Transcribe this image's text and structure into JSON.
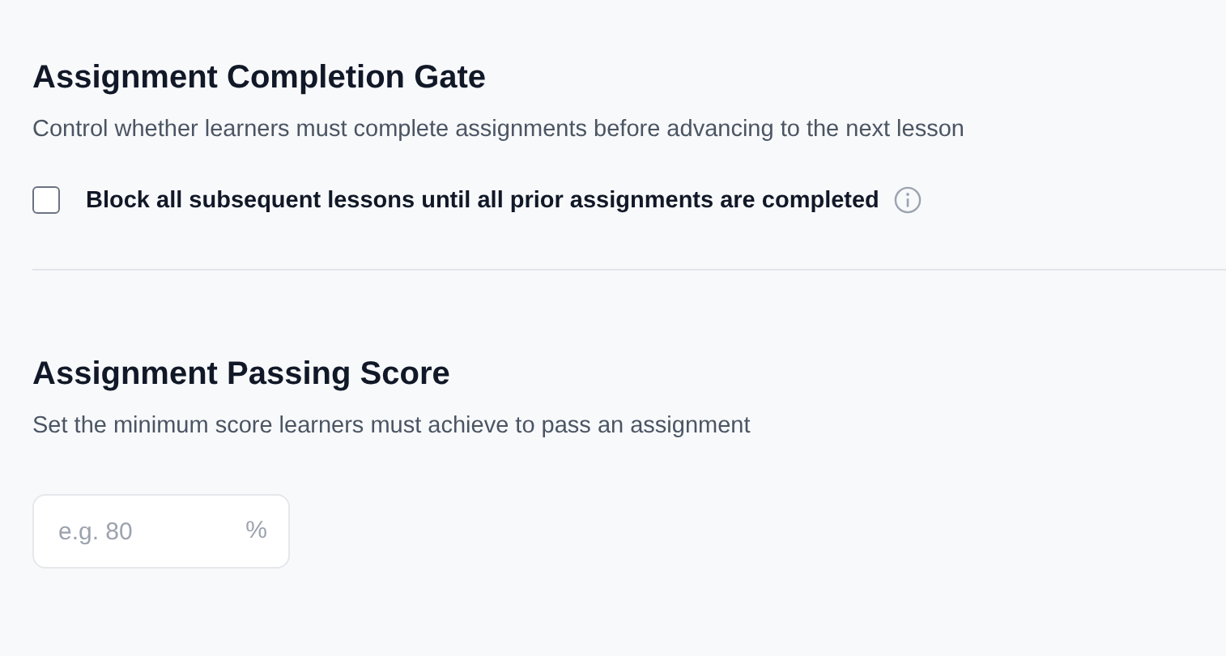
{
  "sections": [
    {
      "title": "Assignment Completion Gate",
      "description": "Control whether learners must complete assignments before advancing to the next lesson",
      "kind": "checkbox",
      "checkbox": {
        "label": "Block all subsequent lessons until all prior assignments are completed",
        "checked": false
      }
    },
    {
      "title": "Assignment Passing Score",
      "description": "Set the minimum score learners must achieve to pass an assignment",
      "kind": "input",
      "input": {
        "placeholder": "e.g. 80",
        "suffix": "%"
      }
    }
  ]
}
